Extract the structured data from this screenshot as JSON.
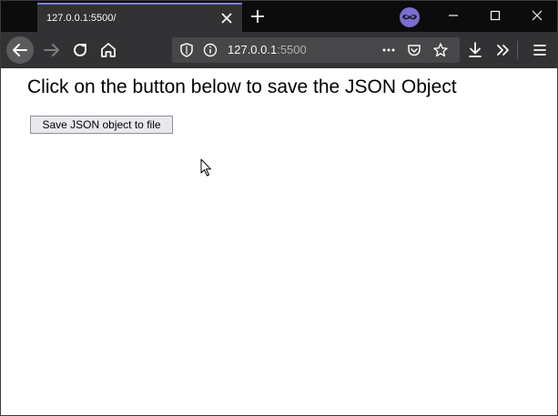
{
  "browser": {
    "tab": {
      "title": "127.0.0.1:5500/"
    },
    "urlbar": {
      "host": "127.0.0.1",
      "port": ":5500"
    },
    "accent_color": "#7a7fd8"
  },
  "page": {
    "heading": "Click on the button below to save the JSON Object",
    "save_button_label": "Save JSON object to file"
  }
}
